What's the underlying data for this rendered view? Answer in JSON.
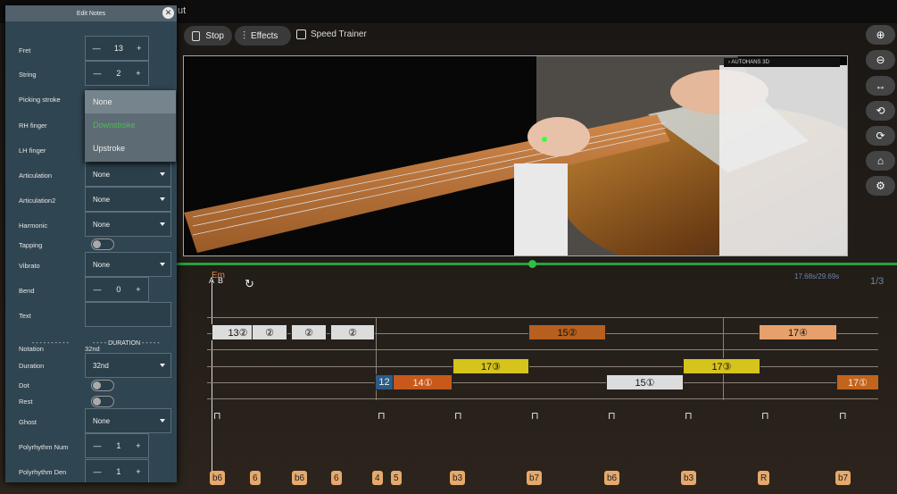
{
  "app": {
    "title_fragment": "ut"
  },
  "controls": {
    "stop": "Stop",
    "effects": "Effects",
    "speed_trainer": "Speed Trainer"
  },
  "video": {
    "badge": "› AUTOHANS 3D"
  },
  "right_toolbar": [
    "zoom-in",
    "zoom-out",
    "fit-width",
    "rotate-left",
    "rotate-right",
    "home",
    "settings"
  ],
  "timeline": {
    "time": "17.68s/29.69s",
    "page": "1/3",
    "chord": "Em",
    "a_label": "A",
    "b_label": "B"
  },
  "notes": [
    {
      "text": "13②",
      "color": "#dcdcdc"
    },
    {
      "text": "②",
      "color": "#dcdcdc"
    },
    {
      "text": "②",
      "color": "#dcdcdc"
    },
    {
      "text": "②",
      "color": "#dcdcdc"
    },
    {
      "text": "15②",
      "color": "#b65f1f"
    },
    {
      "text": "17④",
      "color": "#e7a06b"
    },
    {
      "text": "17③",
      "color": "#d6c31c"
    },
    {
      "text": "17③",
      "color": "#d6c31c"
    },
    {
      "text": "12",
      "color": "#2d5b86"
    },
    {
      "text": "14①",
      "color": "#c8591b"
    },
    {
      "text": "15①",
      "color": "#dcdcdc"
    },
    {
      "text": "17①",
      "color": "#c2641c"
    }
  ],
  "strokes": [
    "⊓",
    "⊓",
    "⊓",
    "⊓",
    "⊓",
    "⊓",
    "⊓",
    "⊓",
    "⊓"
  ],
  "beats": [
    "b6",
    "6",
    "b6",
    "6",
    "4",
    "5",
    "b3",
    "b7",
    "b6",
    "b3",
    "R",
    "b7"
  ],
  "panel": {
    "title": "Edit Notes",
    "fret": {
      "label": "Fret",
      "value": "13"
    },
    "string": {
      "label": "String",
      "value": "2"
    },
    "picking": {
      "label": "Picking stroke",
      "options": [
        "None",
        "Downstroke",
        "Upstroke"
      ]
    },
    "rh_finger": "RH finger",
    "lh_finger": "LH finger",
    "articulation": {
      "label": "Articulation",
      "value": "None"
    },
    "articulation2": {
      "label": "Articulation2",
      "value": "None"
    },
    "harmonic": {
      "label": "Harmonic",
      "value": "None"
    },
    "tapping": "Tapping",
    "vibrato": {
      "label": "Vibrato",
      "value": "None"
    },
    "bend": {
      "label": "Bend",
      "value": "0"
    },
    "text": "Text",
    "sep_left": "- - - - - - - - - -",
    "sep_right": "- - - - DURATION - - - - -",
    "notation": {
      "label": "Notation",
      "value": "32nd"
    },
    "duration": {
      "label": "Duration",
      "value": "32nd"
    },
    "dot": "Dot",
    "rest": "Rest",
    "ghost": {
      "label": "Ghost",
      "value": "None"
    },
    "poly_num": {
      "label": "Polyrhythm Num",
      "value": "1"
    },
    "poly_den": {
      "label": "Polyrhythm Den",
      "value": "1"
    },
    "minus": "—",
    "plus": "+"
  }
}
